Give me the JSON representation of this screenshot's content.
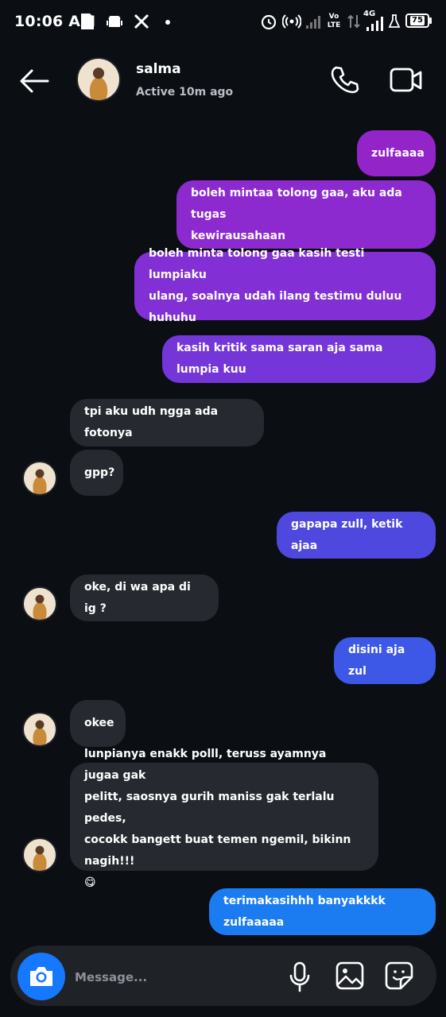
{
  "status_bar": {
    "time": "10:06 AM",
    "network_label": "4G",
    "lte_label": "Vo LTE",
    "battery": "75"
  },
  "header": {
    "contact_name": "salma",
    "presence": "Active 10m ago"
  },
  "messages": [
    {
      "from": "me",
      "text": "zulfaaaa"
    },
    {
      "from": "me",
      "text": "boleh mintaa tolong gaa, aku ada tugas\nkewirausahaan"
    },
    {
      "from": "me",
      "text": "boleh minta tolong gaa kasih testi lumpiaku\nulang, soalnya udah ilang testimu duluu huhuhu"
    },
    {
      "from": "me",
      "text": "kasih kritik sama saran aja sama lumpia kuu"
    },
    {
      "from": "them",
      "text": "tpi aku udh ngga ada fotonya"
    },
    {
      "from": "them",
      "text": "gpp?"
    },
    {
      "from": "me",
      "text": "gapapa zull, ketik ajaa"
    },
    {
      "from": "them",
      "text": "oke, di wa apa di ig ?"
    },
    {
      "from": "me",
      "text": "disini aja zul"
    },
    {
      "from": "them",
      "text": "okee"
    },
    {
      "from": "them",
      "text": "lunpianya enakk polll, teruss ayamnya jugaa gak\npelitt, saosnya gurih maniss gak terlalu pedes,\ncocokk bangett buat temen ngemil, bikinn nagih!!!\n😋"
    },
    {
      "from": "me",
      "text": "terimakasihhh banyakkkk zulfaaaaa"
    }
  ],
  "composer": {
    "placeholder": "Message..."
  },
  "colors": {
    "background": "#0b0f14",
    "incoming_bubble": "#262a30",
    "outgoing_purple": "#8a2bd0",
    "outgoing_violet": "#5b3fe0",
    "outgoing_blue": "#1a7cf0",
    "camera_button": "#1677ff"
  },
  "icons": [
    "back-arrow-icon",
    "phone-icon",
    "video-call-icon",
    "camera-icon",
    "microphone-icon",
    "gallery-icon",
    "sticker-icon"
  ]
}
